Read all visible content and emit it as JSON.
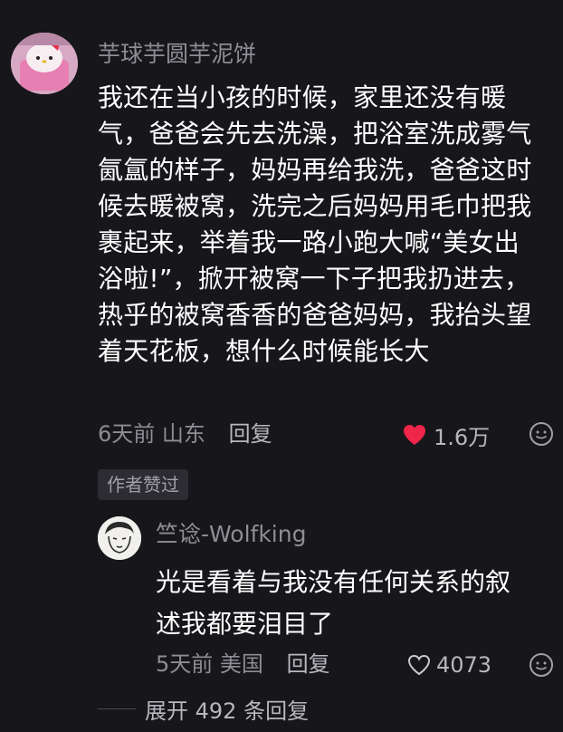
{
  "comment": {
    "username": "芋球芋圆芋泥饼",
    "text_lines": [
      "我还在当小孩的时候，家里还没有暖",
      "气，爸爸会先去洗澡，把浴室洗成雾气",
      "氤氲的样子，妈妈再给我洗，爸爸这时",
      "候去暖被窝，洗完之后妈妈用毛巾把我",
      "裹起来，举着我一路小跑大喊“美女出",
      "浴啦!”，掀开被窝一下子把我扔进去，",
      "热乎的被窝香香的爸爸妈妈，我抬头望",
      "着天花板，想什么时候能长大"
    ],
    "time": "6天前",
    "location": "山东",
    "reply_label": "回复",
    "likes": "1.6万",
    "liked": true,
    "author_badge": "作者赞过"
  },
  "reply": {
    "username": "竺谂-Wolfking",
    "text_lines": [
      "光是看着与我没有任何关系的叙",
      "述我都要泪目了"
    ],
    "time": "5天前",
    "location": "美国",
    "reply_label": "回复",
    "likes": "4073",
    "liked": false
  },
  "expand_label": "展开 492 条回复",
  "icons": {
    "like_filled": "heart-filled-icon",
    "like_outline": "heart-outline-icon",
    "more": "emoji-face-icon"
  },
  "colors": {
    "background": "#17161b",
    "heart": "#f0254a",
    "meta_text": "#8e8d94"
  }
}
